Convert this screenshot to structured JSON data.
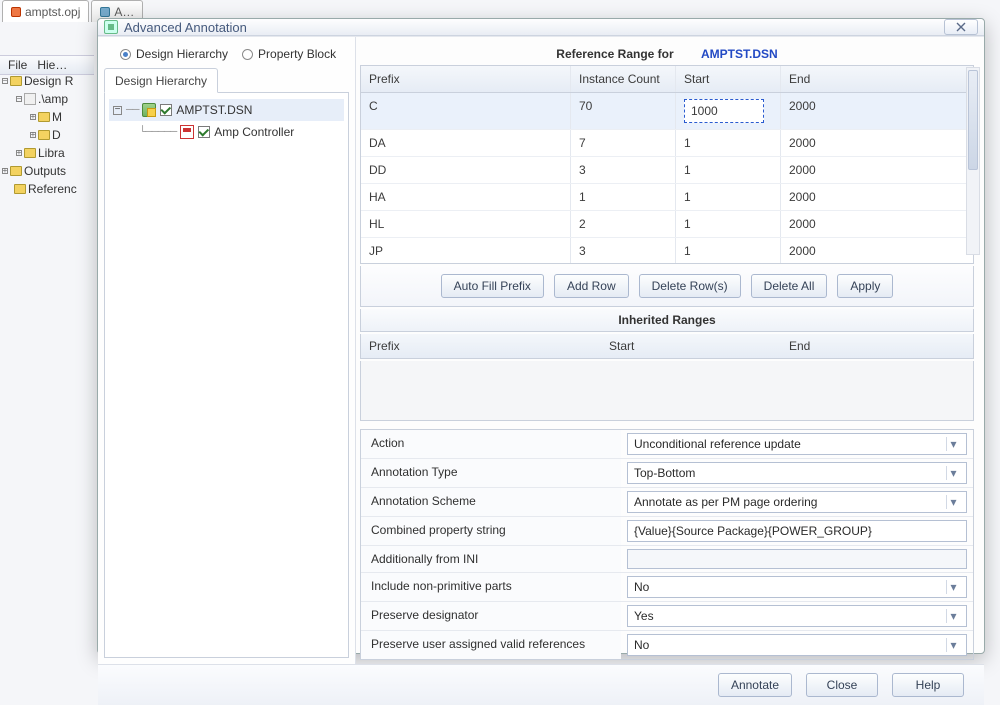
{
  "tabs": {
    "t0": "amptst.opj",
    "t1": "A…"
  },
  "menubar": {
    "file": "File",
    "hier": "Hie…"
  },
  "bgtree": {
    "designR": "Design R",
    "amp": ".\\amp",
    "m": "M",
    "d": "D",
    "libra": "Libra",
    "outputs": "Outputs",
    "refs": "Referenc"
  },
  "dialog": {
    "title": "Advanced Annotation",
    "radios": {
      "dh": "Design Hierarchy",
      "pb": "Property Block"
    },
    "innerTab": "Design Hierarchy",
    "tree": {
      "dsn": "AMPTST.DSN",
      "child": "Amp Controller"
    },
    "rrLabel": "Reference Range for",
    "rrFile": "AMPTST.DSN",
    "gridHead": {
      "prefix": "Prefix",
      "count": "Instance Count",
      "start": "Start",
      "end": "End"
    },
    "rows": [
      {
        "p": "C",
        "n": "70",
        "s": "1000",
        "e": "2000"
      },
      {
        "p": "DA",
        "n": "7",
        "s": "1",
        "e": "2000"
      },
      {
        "p": "DD",
        "n": "3",
        "s": "1",
        "e": "2000"
      },
      {
        "p": "HA",
        "n": "1",
        "s": "1",
        "e": "2000"
      },
      {
        "p": "HL",
        "n": "2",
        "s": "1",
        "e": "2000"
      },
      {
        "p": "JP",
        "n": "3",
        "s": "1",
        "e": "2000"
      }
    ],
    "btns": {
      "autofill": "Auto Fill Prefix",
      "addrow": "Add Row",
      "delrow": "Delete Row(s)",
      "delall": "Delete All",
      "apply": "Apply"
    },
    "inhTitle": "Inherited Ranges",
    "inhHead": {
      "prefix": "Prefix",
      "start": "Start",
      "end": "End"
    },
    "form": {
      "action": {
        "l": "Action",
        "v": "Unconditional reference update"
      },
      "atype": {
        "l": "Annotation Type",
        "v": "Top-Bottom"
      },
      "ascheme": {
        "l": "Annotation Scheme",
        "v": "Annotate as per PM page ordering"
      },
      "combined": {
        "l": "Combined property string",
        "v": "{Value}{Source Package}{POWER_GROUP}"
      },
      "addini": {
        "l": "Additionally from INI",
        "v": ""
      },
      "nonprim": {
        "l": "Include non-primitive parts",
        "v": "No"
      },
      "presdes": {
        "l": "Preserve designator",
        "v": "Yes"
      },
      "presuser": {
        "l": "Preserve user assigned valid references",
        "v": "No"
      }
    },
    "footer": {
      "annotate": "Annotate",
      "close": "Close",
      "help": "Help"
    }
  }
}
